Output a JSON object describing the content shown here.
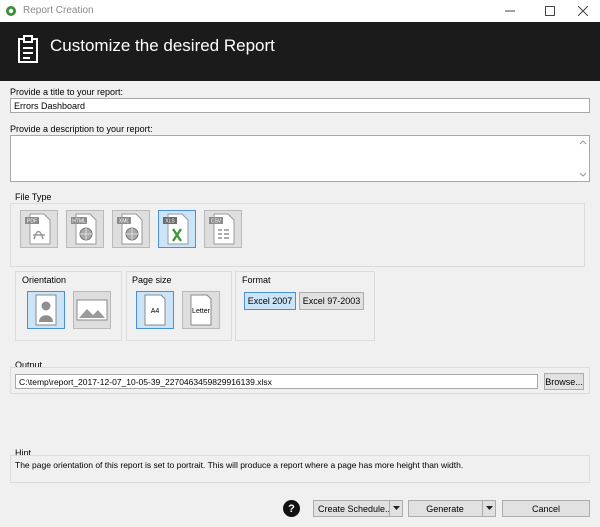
{
  "window": {
    "title": "Report Creation"
  },
  "header": {
    "title": "Customize the desired Report"
  },
  "form": {
    "title_label": "Provide a title to your report:",
    "title_value": "Errors Dashboard",
    "description_label": "Provide a description to your report:",
    "description_value": ""
  },
  "file_type": {
    "label": "File Type",
    "items": [
      {
        "name": "pdf",
        "tag": "PDF",
        "selected": false
      },
      {
        "name": "html",
        "tag": "HTML",
        "selected": false
      },
      {
        "name": "xml",
        "tag": "XML",
        "selected": false
      },
      {
        "name": "xls",
        "tag": "XLS",
        "selected": true
      },
      {
        "name": "csv",
        "tag": "CSV",
        "selected": false
      }
    ]
  },
  "orientation": {
    "label": "Orientation",
    "selected": "portrait"
  },
  "page_size": {
    "label": "Page size",
    "a4": "A4",
    "letter": "Letter",
    "selected": "A4"
  },
  "format": {
    "label": "Format",
    "excel2007": "Excel 2007",
    "excel97": "Excel 97-2003",
    "selected": "Excel 2007"
  },
  "output": {
    "label": "Output",
    "path": "C:\\temp\\report_2017-12-07_10-05-39_2270463459829916139.xlsx",
    "browse": "Browse..."
  },
  "hint": {
    "label": "Hint",
    "text": "The page orientation of this report is set to portrait. This will produce a report where a page has more height than width."
  },
  "footer": {
    "help": "?",
    "create_schedule": "Create Schedule...",
    "generate": "Generate",
    "cancel": "Cancel"
  },
  "colors": {
    "header_bg": "#1b1b1b",
    "selection": "#cce4f7",
    "selection_border": "#4a90d9"
  }
}
